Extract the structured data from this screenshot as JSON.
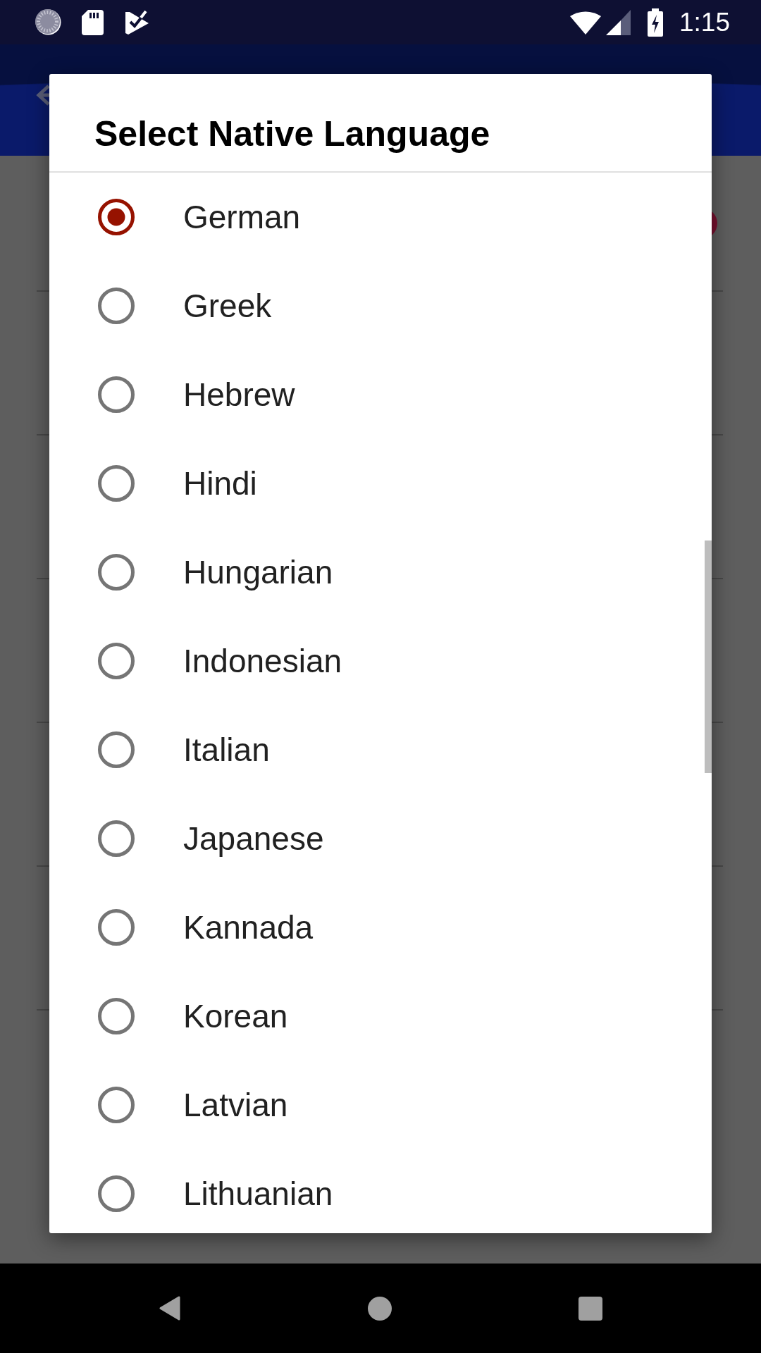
{
  "status_bar": {
    "time": "1:15"
  },
  "dialog": {
    "title": "Select Native Language",
    "options": [
      {
        "label": "German",
        "selected": true
      },
      {
        "label": "Greek",
        "selected": false
      },
      {
        "label": "Hebrew",
        "selected": false
      },
      {
        "label": "Hindi",
        "selected": false
      },
      {
        "label": "Hungarian",
        "selected": false
      },
      {
        "label": "Indonesian",
        "selected": false
      },
      {
        "label": "Italian",
        "selected": false
      },
      {
        "label": "Japanese",
        "selected": false
      },
      {
        "label": "Kannada",
        "selected": false
      },
      {
        "label": "Korean",
        "selected": false
      },
      {
        "label": "Latvian",
        "selected": false
      },
      {
        "label": "Lithuanian",
        "selected": false
      }
    ]
  }
}
